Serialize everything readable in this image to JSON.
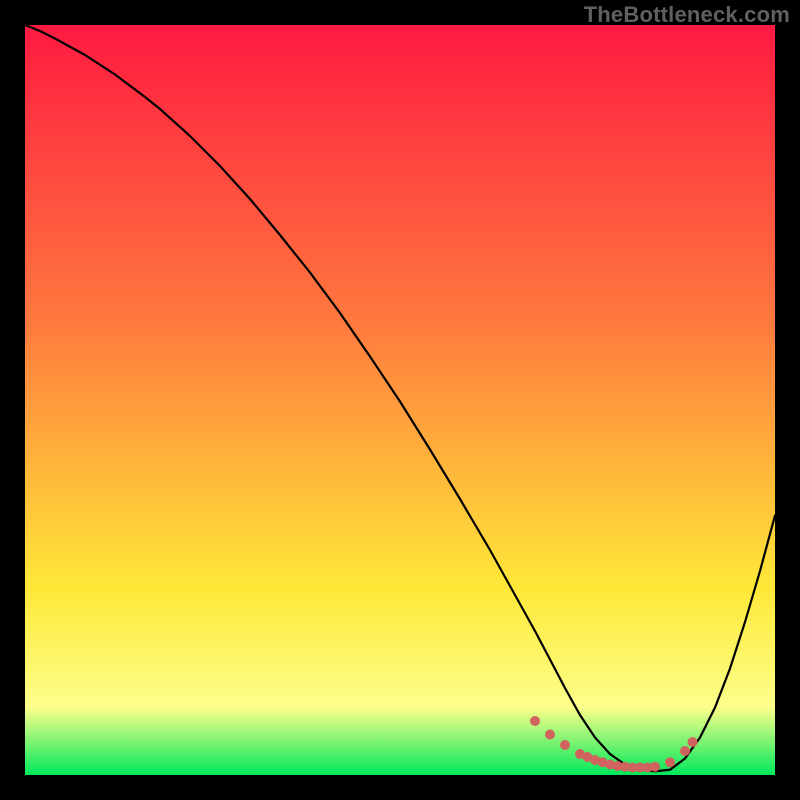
{
  "watermark": "TheBottleneck.com",
  "colors": {
    "frame": "#000000",
    "gradient_top": "#ff1a41",
    "gradient_mid1": "#ff7a3e",
    "gradient_mid2": "#ffe838",
    "gradient_mid3": "#fcff8a",
    "gradient_bottom": "#00e85b",
    "curve": "#000000",
    "DOTS": "#d1635e"
  },
  "chart_data": {
    "type": "line",
    "title": "",
    "xlabel": "",
    "ylabel": "",
    "xlim": [
      0,
      100
    ],
    "ylim": [
      0,
      100
    ],
    "series": [
      {
        "name": "bottleneck-curve",
        "x": [
          0,
          2,
          4,
          8,
          12,
          16,
          18,
          22,
          26,
          30,
          34,
          38,
          42,
          46,
          50,
          54,
          58,
          62,
          64,
          66,
          68,
          70,
          72,
          74,
          76,
          78,
          80,
          82,
          84,
          86,
          88,
          90,
          92,
          94,
          96,
          98,
          100
        ],
        "y": [
          100,
          99.2,
          98.2,
          96.0,
          93.4,
          90.4,
          88.8,
          85.2,
          81.2,
          76.8,
          72.0,
          67.0,
          61.6,
          55.8,
          49.8,
          43.4,
          36.8,
          30.0,
          26.4,
          22.8,
          19.2,
          15.4,
          11.6,
          8.0,
          5.0,
          2.8,
          1.4,
          0.7,
          0.5,
          0.7,
          2.2,
          5.0,
          9.0,
          14.2,
          20.4,
          27.2,
          34.6
        ]
      },
      {
        "name": "optimal-range-dots",
        "x": [
          68,
          70,
          72,
          74,
          75,
          76,
          77,
          78,
          79,
          80,
          81,
          82,
          83,
          84,
          86,
          88,
          89
        ],
        "y": [
          7.2,
          5.4,
          4.0,
          2.8,
          2.4,
          2.0,
          1.7,
          1.4,
          1.2,
          1.1,
          1.0,
          1.0,
          1.0,
          1.1,
          1.7,
          3.2,
          4.4
        ]
      }
    ]
  }
}
